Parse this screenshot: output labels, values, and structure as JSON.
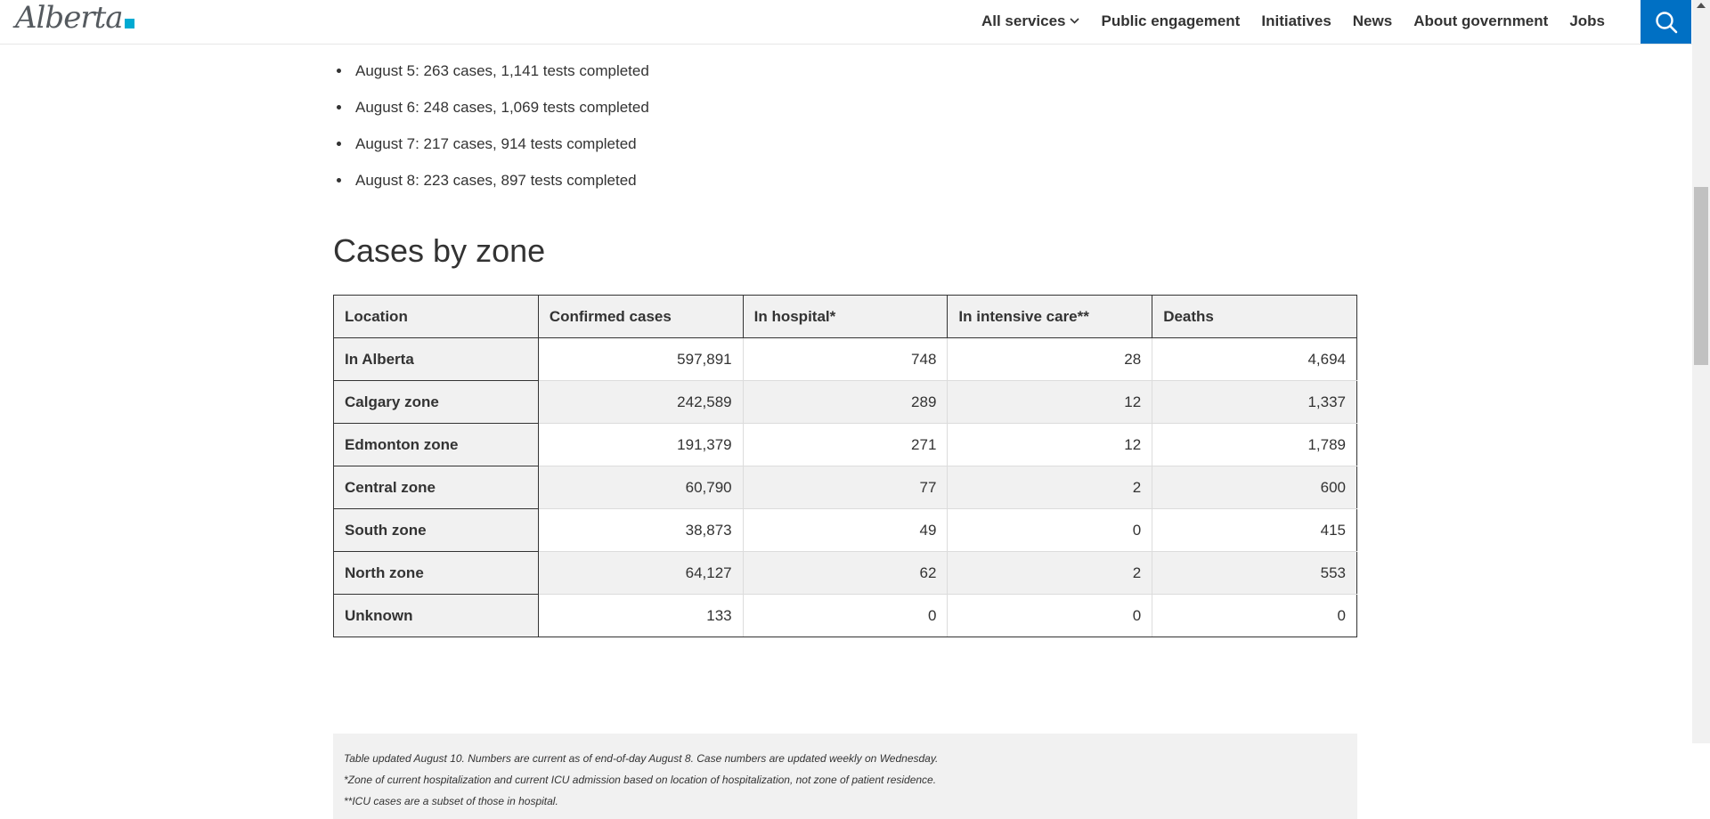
{
  "header": {
    "logo_text": "Alberta",
    "nav": [
      {
        "label": "All services",
        "has_dropdown": true
      },
      {
        "label": "Public engagement"
      },
      {
        "label": "Initiatives"
      },
      {
        "label": "News"
      },
      {
        "label": "About government"
      },
      {
        "label": "Jobs"
      }
    ],
    "search_icon": "search-icon",
    "accent_color": "#0070c4"
  },
  "bullets": [
    "August 5: 263 cases, 1,141 tests completed",
    "August 6: 248 cases, 1,069 tests completed",
    "August 7: 217 cases, 914 tests completed",
    "August 8: 223 cases, 897 tests completed"
  ],
  "section_title": "Cases by zone",
  "table": {
    "headers": [
      "Location",
      "Confirmed cases",
      "In hospital*",
      "In intensive care**",
      "Deaths"
    ],
    "rows": [
      [
        "In Alberta",
        "597,891",
        "748",
        "28",
        "4,694"
      ],
      [
        "Calgary zone",
        "242,589",
        "289",
        "12",
        "1,337"
      ],
      [
        "Edmonton zone",
        "191,379",
        "271",
        "12",
        "1,789"
      ],
      [
        "Central zone",
        "60,790",
        "77",
        "2",
        "600"
      ],
      [
        "South zone",
        "38,873",
        "49",
        "0",
        "415"
      ],
      [
        "North zone",
        "64,127",
        "62",
        "2",
        "553"
      ],
      [
        "Unknown",
        "133",
        "0",
        "0",
        "0"
      ]
    ]
  },
  "notes": [
    "Table updated August 10. Numbers are current as of end-of-day August 8. Case numbers are updated weekly on Wednesday.",
    "*Zone of current hospitalization and current ICU admission based on location of hospitalization, not zone of patient residence.",
    "**ICU cases are a subset of those in hospital."
  ]
}
